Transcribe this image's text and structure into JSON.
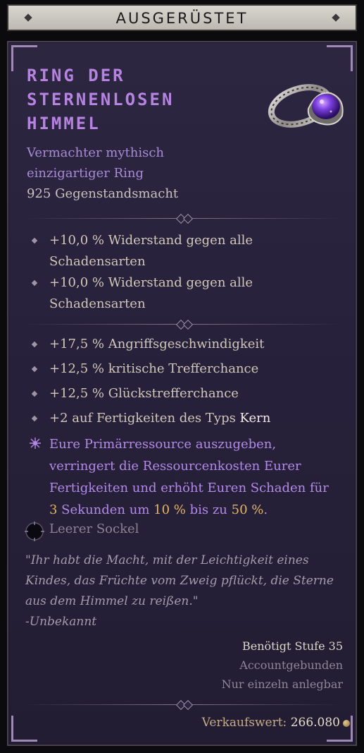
{
  "header": {
    "title": "AUSGERÜSTET"
  },
  "item": {
    "name_lines": [
      "RING DER",
      "STERNENLOSEN",
      "HIMMEL"
    ],
    "subtype_lines": [
      "Vermachter mythisch",
      "einzigartiger Ring"
    ],
    "item_power": "925 Gegenstandsmacht",
    "icon": "ring-icon"
  },
  "implicit_affixes": [
    {
      "line1": "+10,0 % Widerstand gegen alle",
      "line2": "Schadensarten"
    },
    {
      "line1": "+10,0 % Widerstand gegen alle",
      "line2": "Schadensarten"
    }
  ],
  "affixes": [
    {
      "text": "+17,5 % Angriffsgeschwindigkeit"
    },
    {
      "text": "+12,5 % kritische Trefferchance"
    },
    {
      "text": "+12,5 % Glückstrefferchance"
    },
    {
      "text": "+2 auf Fertigkeiten des Typs ",
      "keyword": "Kern"
    }
  ],
  "unique_power": {
    "line1": "Eure Primärressource auszugeben,",
    "line2": "verringert die Ressourcenkosten Eurer",
    "line3": "Fertigkeiten und erhöht Euren Schaden für",
    "n1": "3",
    "t1": " Sekunden um ",
    "n2": "10 %",
    "t2": " bis zu ",
    "n3": "50 %",
    "t3": "."
  },
  "socket": {
    "label": "Leerer Sockel"
  },
  "flavor": {
    "line1": "\"Ihr habt die Macht, mit der Leichtigkeit eines",
    "line2": "Kindes, das Früchte vom Zweig pflückt, die Sterne",
    "line3": "aus dem Himmel zu reißen.\"",
    "attribution": "-Unbekannt"
  },
  "requirements": {
    "level": "Benötigt Stufe 35",
    "account_bound": "Accountgebunden",
    "unique_equipped": "Nur einzeln anlegbar"
  },
  "sell": {
    "label": "Verkaufswert:",
    "value": "266.080"
  },
  "colors": {
    "name": "#b684e0",
    "subtype": "#a98ad6",
    "unique_power": "#b38ae8",
    "number_highlight": "#e4b665",
    "panel": "#2a243c"
  }
}
